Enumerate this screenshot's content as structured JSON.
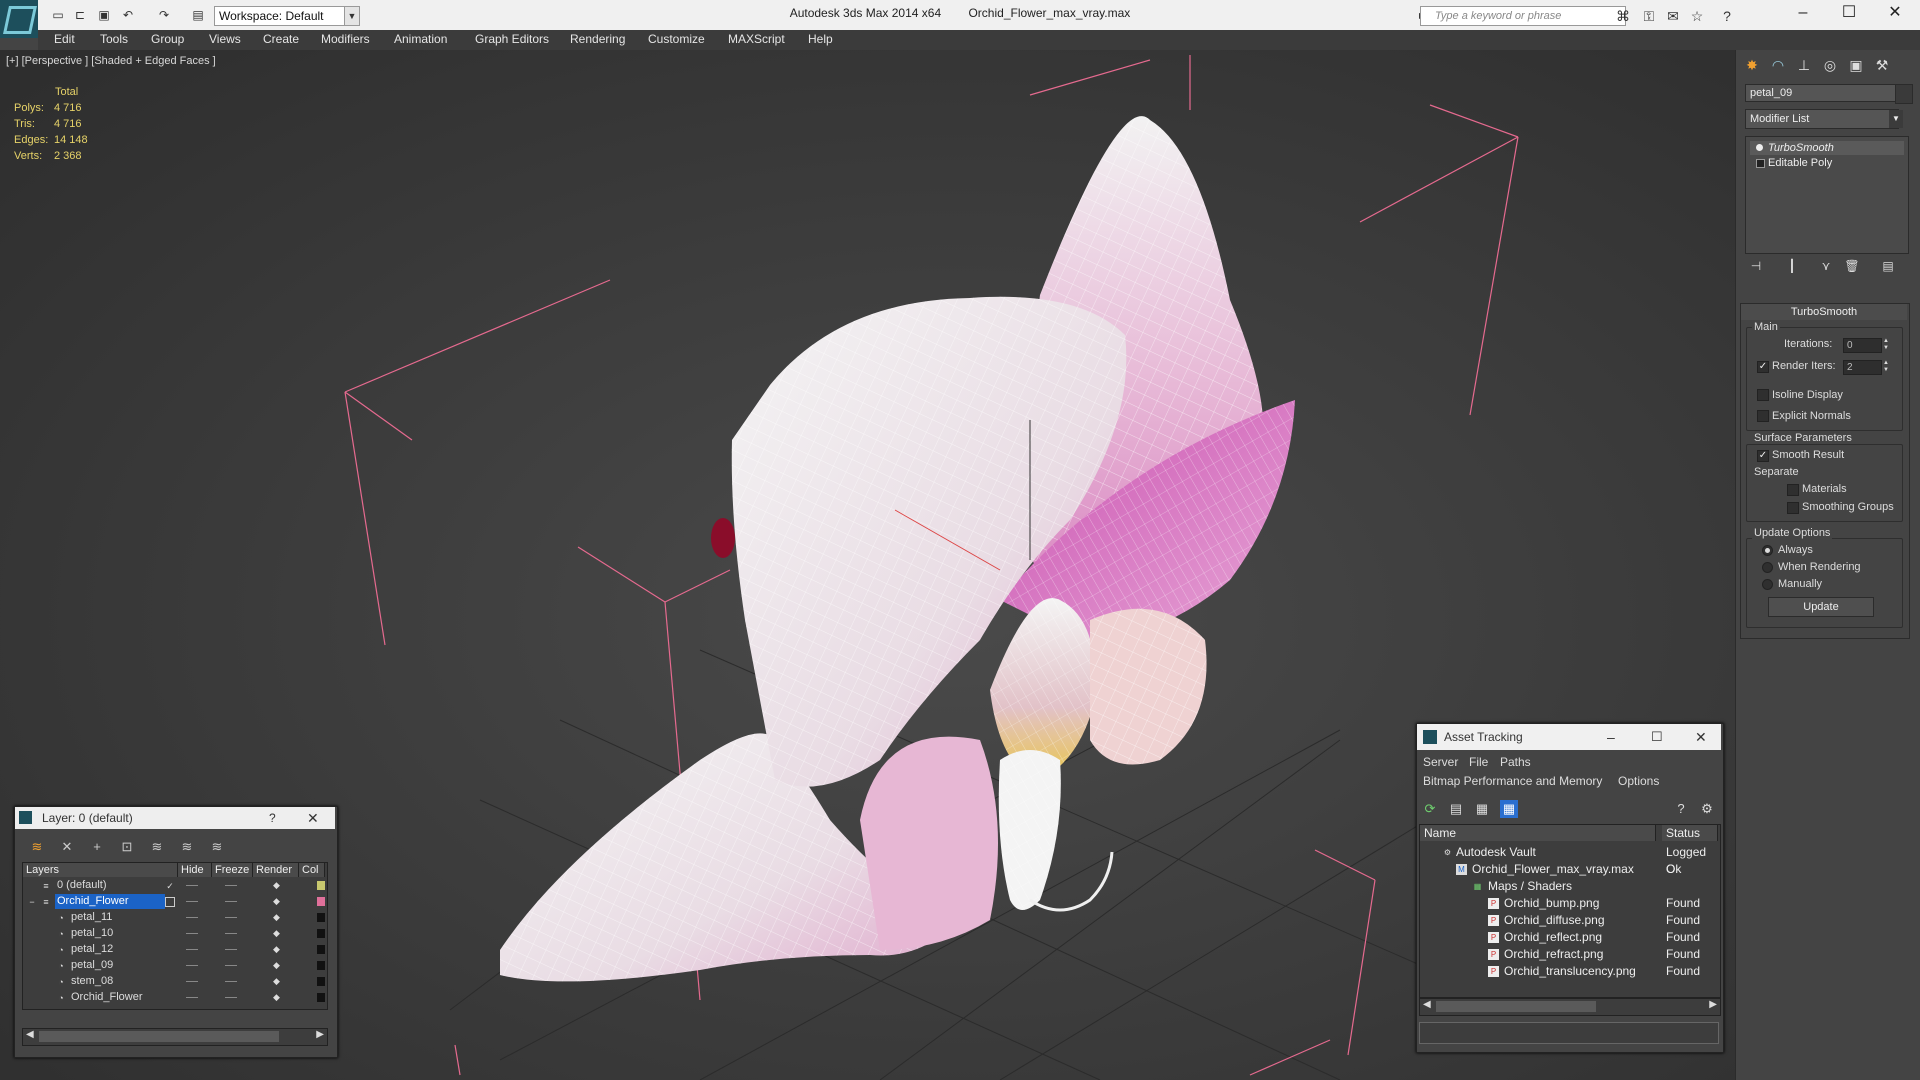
{
  "app": {
    "product": "Autodesk 3ds Max 2014 x64",
    "file": "Orchid_Flower_max_vray.max",
    "workspace": "Workspace: Default",
    "search_placeholder": "Type a keyword or phrase"
  },
  "menu": [
    "Edit",
    "Tools",
    "Group",
    "Views",
    "Create",
    "Modifiers",
    "Animation",
    "Graph Editors",
    "Rendering",
    "Customize",
    "MAXScript",
    "Help"
  ],
  "viewport": {
    "label": "[+] [Perspective ] [Shaded + Edged Faces ]",
    "stats": {
      "header": "Total",
      "rows": [
        {
          "label": "Polys:",
          "value": "4 716"
        },
        {
          "label": "Tris:",
          "value": "4 716"
        },
        {
          "label": "Edges:",
          "value": "14 148"
        },
        {
          "label": "Verts:",
          "value": "2 368"
        }
      ]
    }
  },
  "command_panel": {
    "object_name": "petal_09",
    "modifier_list": "Modifier List",
    "stack": [
      "TurboSmooth",
      "Editable Poly"
    ],
    "turbosmooth": {
      "title": "TurboSmooth",
      "main_label": "Main",
      "iterations_label": "Iterations:",
      "iterations_value": "0",
      "render_iters_label": "Render Iters:",
      "render_iters_value": "2",
      "isoline_label": "Isoline Display",
      "explicit_normals_label": "Explicit Normals",
      "surface_params_label": "Surface Parameters",
      "smooth_result_label": "Smooth Result",
      "separate_label": "Separate",
      "materials_label": "Materials",
      "smoothing_groups_label": "Smoothing Groups",
      "update_options_label": "Update Options",
      "always_label": "Always",
      "when_rendering_label": "When Rendering",
      "manually_label": "Manually",
      "update_button": "Update"
    }
  },
  "layer_panel": {
    "title": "Layer: 0 (default)",
    "help": "?",
    "headers": {
      "layers": "Layers",
      "hide": "Hide",
      "freeze": "Freeze",
      "render": "Render",
      "color": "Col"
    },
    "rows": [
      {
        "name": "0 (default)",
        "color": "#c8c86e"
      },
      {
        "name": "Orchid_Flower",
        "color": "#e0709a"
      },
      {
        "name": "petal_11",
        "color": "#111111"
      },
      {
        "name": "petal_10",
        "color": "#111111"
      },
      {
        "name": "petal_12",
        "color": "#111111"
      },
      {
        "name": "petal_09",
        "color": "#111111"
      },
      {
        "name": "stem_08",
        "color": "#111111"
      },
      {
        "name": "Orchid_Flower",
        "color": "#111111"
      }
    ]
  },
  "asset_tracking": {
    "title": "Asset Tracking",
    "menu1": [
      "Server",
      "File",
      "Paths"
    ],
    "menu2": [
      "Bitmap Performance and Memory",
      "Options"
    ],
    "headers": {
      "name": "Name",
      "status": "Status"
    },
    "rows": [
      {
        "name": "Autodesk Vault",
        "status": "Logged O"
      },
      {
        "name": "Orchid_Flower_max_vray.max",
        "status": "Ok"
      },
      {
        "name": "Maps / Shaders",
        "status": ""
      },
      {
        "name": "Orchid_bump.png",
        "status": "Found"
      },
      {
        "name": "Orchid_diffuse.png",
        "status": "Found"
      },
      {
        "name": "Orchid_reflect.png",
        "status": "Found"
      },
      {
        "name": "Orchid_refract.png",
        "status": "Found"
      },
      {
        "name": "Orchid_translucency.png",
        "status": "Found"
      }
    ]
  },
  "colors": {
    "stats_text": "#e6d268",
    "selection": "#1b63c6",
    "petal_pink": "#e8a8cf",
    "petal_magenta": "#c94fb0"
  }
}
